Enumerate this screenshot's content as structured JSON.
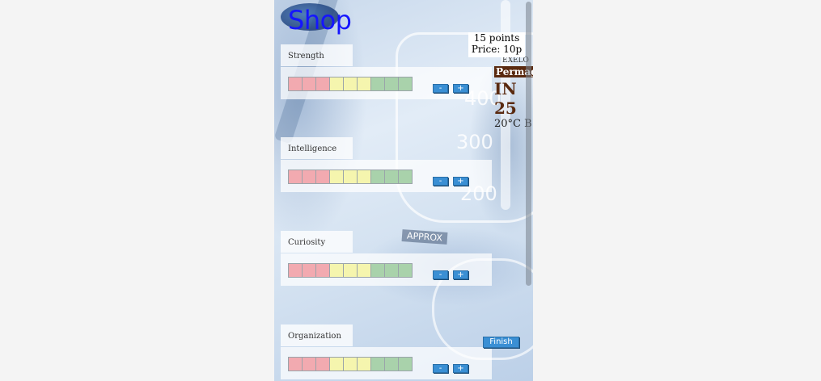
{
  "shop": {
    "title": "Shop",
    "points": "15 points",
    "price": "Price: 10p"
  },
  "colors": {
    "low": "#f2aab0",
    "mid": "#f5f5ae",
    "high": "#a9d2ab",
    "button": "#3a8fd4",
    "title": "#1515ff"
  },
  "stats": [
    {
      "label": "Strength"
    },
    {
      "label": "Intelligence"
    },
    {
      "label": "Curiosity"
    },
    {
      "label": "Organization"
    }
  ],
  "bar_levels": [
    "low",
    "low",
    "low",
    "mid",
    "mid",
    "mid",
    "high",
    "high",
    "high"
  ],
  "buttons": {
    "minus": "-",
    "plus": "+",
    "finish": "Finish"
  },
  "background_text": {
    "n400": "400",
    "n300": "300",
    "n200": "200",
    "approx": "APPROX",
    "label_l1": "EXELO",
    "label_l2": "Permag",
    "label_l3": "IN 25",
    "label_l4": "20°C B"
  }
}
